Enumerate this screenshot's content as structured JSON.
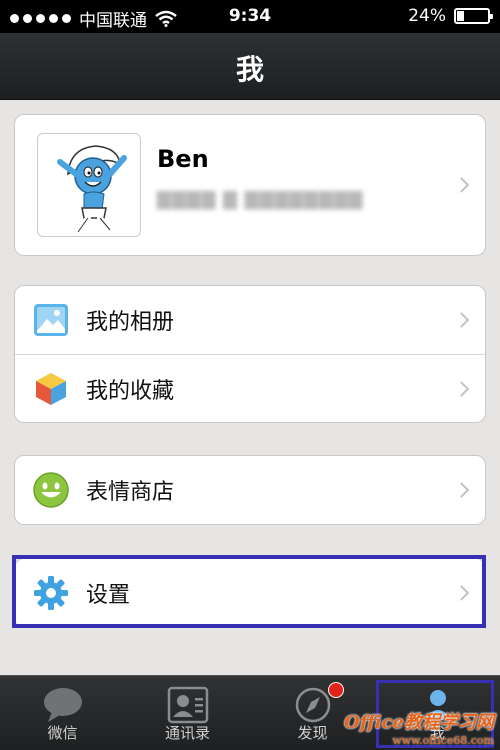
{
  "status_bar": {
    "carrier": "中国联通",
    "time": "9:34",
    "battery": "24%",
    "battery_level": 0.24
  },
  "nav": {
    "title": "我"
  },
  "profile": {
    "name": "Ben",
    "account_id": "",
    "avatar_icon": "smurf-avatar"
  },
  "menu": {
    "album": {
      "label": "我的相册",
      "icon": "album-icon"
    },
    "favorites": {
      "label": "我的收藏",
      "icon": "favorites-cube-icon"
    },
    "sticker_shop": {
      "label": "表情商店",
      "icon": "smiley-icon"
    },
    "settings": {
      "label": "设置",
      "icon": "gear-icon"
    }
  },
  "tabs": [
    {
      "label": "微信",
      "icon": "chat-bubble-icon"
    },
    {
      "label": "通讯录",
      "icon": "contacts-card-icon"
    },
    {
      "label": "发现",
      "icon": "compass-icon",
      "has_badge": true
    },
    {
      "label": "我",
      "icon": "person-icon",
      "selected": true
    }
  ],
  "watermark": {
    "main": "Office教程学习网",
    "url": "www.office68.com"
  },
  "colors": {
    "highlight": "#3730b5",
    "badge": "#e2231a",
    "gear_blue": "#3ea3e0",
    "smiley_green": "#8cc63e"
  }
}
